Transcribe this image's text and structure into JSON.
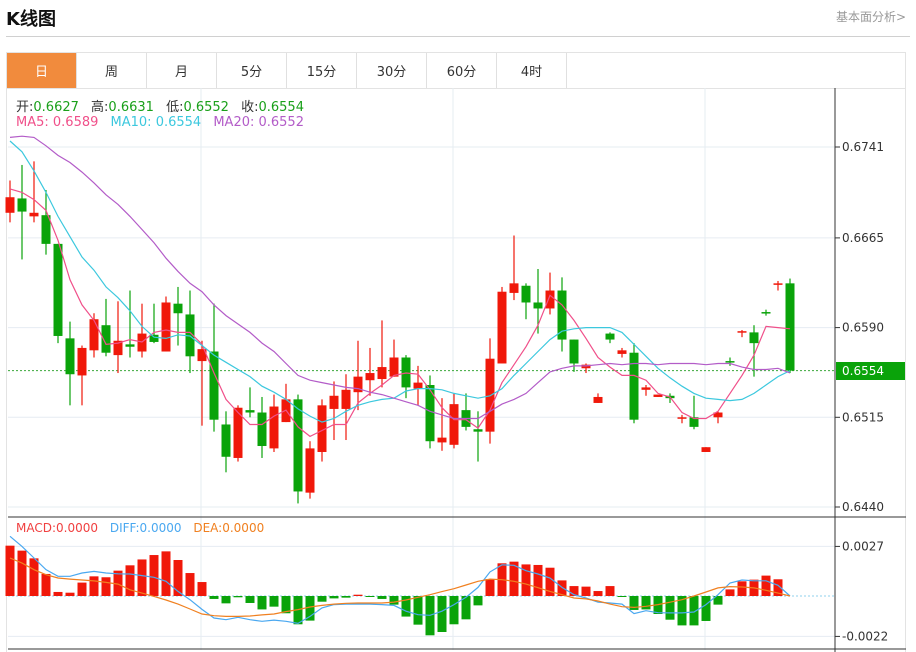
{
  "header": {
    "title": "K线图",
    "link": "基本面分析>"
  },
  "tabs": [
    {
      "label": "日",
      "active": true
    },
    {
      "label": "周"
    },
    {
      "label": "月"
    },
    {
      "label": "5分"
    },
    {
      "label": "15分"
    },
    {
      "label": "30分"
    },
    {
      "label": "60分"
    },
    {
      "label": "4时"
    }
  ],
  "ohlc": {
    "open_label": "开:",
    "open": "0.6627",
    "high_label": "高:",
    "high": "0.6631",
    "low_label": "低:",
    "low": "0.6552",
    "close_label": "收:",
    "close": "0.6554"
  },
  "ma": {
    "ma5": "MA5: 0.6589",
    "ma10": "MA10: 0.6554",
    "ma20": "MA20: 0.6552"
  },
  "macd_info": {
    "macd": "MACD:0.0000",
    "diff": "DIFF:0.0000",
    "dea": "DEA:0.0000"
  },
  "current_price": "0.6554",
  "colors": {
    "up": "#f0180a",
    "down": "#0aa30a",
    "ma5": "#f0508a",
    "ma10": "#3cc8de",
    "ma20": "#b35cc8",
    "macd": "#f04040",
    "diff": "#4aa8f0",
    "dea": "#f08020",
    "accent": "#f18b3d"
  },
  "chart_data": [
    {
      "type": "candlestick",
      "title": "K线图",
      "y_ticks": [
        "0.6741",
        "0.6665",
        "0.6590",
        "0.6515",
        "0.6440"
      ],
      "ylim": [
        0.644,
        0.6741
      ],
      "grid": true,
      "candles_ohlc": [
        [
          0.6686,
          0.6713,
          0.6678,
          0.6699
        ],
        [
          0.6698,
          0.6726,
          0.6647,
          0.6687
        ],
        [
          0.6683,
          0.6729,
          0.6678,
          0.6686
        ],
        [
          0.6684,
          0.6705,
          0.6651,
          0.666
        ],
        [
          0.666,
          0.666,
          0.6577,
          0.6583
        ],
        [
          0.6581,
          0.6595,
          0.6525,
          0.6551
        ],
        [
          0.655,
          0.6575,
          0.6525,
          0.6573
        ],
        [
          0.6571,
          0.6602,
          0.6565,
          0.6597
        ],
        [
          0.6592,
          0.6614,
          0.6566,
          0.6569
        ],
        [
          0.6567,
          0.6612,
          0.6552,
          0.6579
        ],
        [
          0.6576,
          0.6621,
          0.6565,
          0.6574
        ],
        [
          0.657,
          0.661,
          0.6565,
          0.6585
        ],
        [
          0.6584,
          0.661,
          0.6577,
          0.6578
        ],
        [
          0.657,
          0.6616,
          0.657,
          0.6611
        ],
        [
          0.661,
          0.6624,
          0.6575,
          0.6602
        ],
        [
          0.6601,
          0.6621,
          0.6552,
          0.6566
        ],
        [
          0.6562,
          0.6579,
          0.6508,
          0.6572
        ],
        [
          0.657,
          0.661,
          0.6503,
          0.6513
        ],
        [
          0.6509,
          0.652,
          0.6469,
          0.6482
        ],
        [
          0.6481,
          0.6525,
          0.6478,
          0.6523
        ],
        [
          0.6521,
          0.654,
          0.6515,
          0.6519
        ],
        [
          0.6519,
          0.6532,
          0.6481,
          0.6491
        ],
        [
          0.6489,
          0.6534,
          0.6486,
          0.6524
        ],
        [
          0.6511,
          0.6543,
          0.6511,
          0.653
        ],
        [
          0.653,
          0.6534,
          0.6443,
          0.6453
        ],
        [
          0.6452,
          0.6495,
          0.6447,
          0.6489
        ],
        [
          0.6486,
          0.653,
          0.6478,
          0.6525
        ],
        [
          0.6522,
          0.6545,
          0.6496,
          0.6533
        ],
        [
          0.6522,
          0.6551,
          0.6496,
          0.6538
        ],
        [
          0.6536,
          0.6579,
          0.6521,
          0.6549
        ],
        [
          0.6546,
          0.6573,
          0.6533,
          0.6552
        ],
        [
          0.6547,
          0.6596,
          0.654,
          0.6557
        ],
        [
          0.6549,
          0.658,
          0.6549,
          0.6565
        ],
        [
          0.6565,
          0.6567,
          0.6531,
          0.654
        ],
        [
          0.6539,
          0.6558,
          0.6525,
          0.6544
        ],
        [
          0.6542,
          0.655,
          0.6489,
          0.6495
        ],
        [
          0.6494,
          0.6531,
          0.6487,
          0.6498
        ],
        [
          0.6492,
          0.6535,
          0.6489,
          0.6526
        ],
        [
          0.6521,
          0.6535,
          0.6504,
          0.6507
        ],
        [
          0.6505,
          0.652,
          0.6478,
          0.6503
        ],
        [
          0.6503,
          0.6581,
          0.6493,
          0.6564
        ],
        [
          0.656,
          0.6624,
          0.656,
          0.662
        ],
        [
          0.6619,
          0.6667,
          0.6613,
          0.6627
        ],
        [
          0.6625,
          0.6627,
          0.6597,
          0.6611
        ],
        [
          0.6611,
          0.6639,
          0.6585,
          0.6606
        ],
        [
          0.6606,
          0.6636,
          0.6601,
          0.6621
        ],
        [
          0.6621,
          0.6632,
          0.657,
          0.658
        ],
        [
          0.658,
          0.658,
          0.6553,
          0.656
        ],
        [
          0.6556,
          0.656,
          0.6552,
          0.6559
        ],
        [
          0.6527,
          0.6535,
          0.6527,
          0.6532
        ],
        [
          0.6585,
          0.6586,
          0.6577,
          0.658
        ],
        [
          0.6568,
          0.6573,
          0.6565,
          0.6571
        ],
        [
          0.6569,
          0.6577,
          0.651,
          0.6513
        ],
        [
          0.6538,
          0.6542,
          0.6533,
          0.654
        ],
        [
          0.6532,
          0.6534,
          0.6532,
          0.6534
        ],
        [
          0.6533,
          0.6535,
          0.6527,
          0.6531
        ],
        [
          0.6514,
          0.6517,
          0.651,
          0.6515
        ],
        [
          0.6515,
          0.6533,
          0.6505,
          0.6507
        ],
        [
          0.6486,
          0.649,
          0.6486,
          0.649
        ],
        [
          0.6515,
          0.652,
          0.651,
          0.6519
        ],
        [
          0.6562,
          0.6565,
          0.6558,
          0.6561
        ],
        [
          0.6586,
          0.6588,
          0.6582,
          0.6587
        ],
        [
          0.6586,
          0.6592,
          0.6549,
          0.6577
        ],
        [
          0.6603,
          0.6605,
          0.66,
          0.6602
        ],
        [
          0.6627,
          0.6629,
          0.6621,
          0.6627
        ],
        [
          0.6627,
          0.6631,
          0.6552,
          0.6554
        ]
      ],
      "series": [
        {
          "name": "MA5",
          "values": [
            0.6706,
            0.6703,
            0.6697,
            0.6688,
            0.6663,
            0.663,
            0.6609,
            0.6596,
            0.6576,
            0.6577,
            0.658,
            0.6578,
            0.6586,
            0.6588,
            0.6586,
            0.6586,
            0.6576,
            0.6552,
            0.653,
            0.6519,
            0.6509,
            0.6509,
            0.6516,
            0.6521,
            0.6507,
            0.6499,
            0.6504,
            0.6509,
            0.6509,
            0.6527,
            0.6535,
            0.6542,
            0.655,
            0.6552,
            0.6551,
            0.6538,
            0.6523,
            0.6513,
            0.6513,
            0.6506,
            0.6521,
            0.6544,
            0.6559,
            0.6574,
            0.6592,
            0.6617,
            0.6609,
            0.6596,
            0.6581,
            0.6565,
            0.6557,
            0.655,
            0.655,
            0.6546,
            0.6535,
            0.6532,
            0.6519,
            0.6514,
            0.6514,
            0.652,
            0.6535,
            0.655,
            0.6567,
            0.6591,
            0.659,
            0.6589
          ]
        },
        {
          "name": "MA10",
          "values": [
            0.6746,
            0.6737,
            0.6721,
            0.6703,
            0.6683,
            0.6666,
            0.6649,
            0.6638,
            0.6624,
            0.6615,
            0.6604,
            0.6591,
            0.6582,
            0.6581,
            0.6584,
            0.6583,
            0.6575,
            0.6567,
            0.6561,
            0.6555,
            0.6549,
            0.6541,
            0.6536,
            0.653,
            0.6522,
            0.6516,
            0.6511,
            0.6514,
            0.652,
            0.6525,
            0.6528,
            0.653,
            0.6531,
            0.6537,
            0.6539,
            0.6539,
            0.6538,
            0.6535,
            0.6533,
            0.6531,
            0.6533,
            0.6539,
            0.655,
            0.656,
            0.657,
            0.658,
            0.6587,
            0.6589,
            0.659,
            0.659,
            0.659,
            0.6586,
            0.6576,
            0.6566,
            0.6556,
            0.6548,
            0.6541,
            0.6535,
            0.6531,
            0.653,
            0.6529,
            0.653,
            0.6535,
            0.6542,
            0.6549,
            0.6554
          ]
        },
        {
          "name": "MA20",
          "values": [
            0.6749,
            0.675,
            0.6749,
            0.6742,
            0.6734,
            0.6728,
            0.672,
            0.6711,
            0.6701,
            0.6693,
            0.6683,
            0.6672,
            0.6661,
            0.6648,
            0.6637,
            0.6627,
            0.662,
            0.6609,
            0.66,
            0.6593,
            0.6586,
            0.6577,
            0.657,
            0.656,
            0.655,
            0.6546,
            0.6544,
            0.6542,
            0.654,
            0.6539,
            0.6536,
            0.6534,
            0.6531,
            0.6528,
            0.6525,
            0.652,
            0.6517,
            0.6514,
            0.6514,
            0.6514,
            0.652,
            0.6526,
            0.653,
            0.6535,
            0.6544,
            0.6553,
            0.6556,
            0.6558,
            0.6558,
            0.6559,
            0.656,
            0.6559,
            0.656,
            0.656,
            0.6559,
            0.656,
            0.656,
            0.656,
            0.6559,
            0.656,
            0.656,
            0.6557,
            0.6555,
            0.6555,
            0.6556,
            0.6552
          ]
        }
      ]
    },
    {
      "type": "bar",
      "title": "MACD",
      "y_ticks": [
        "0.0027",
        "-0.0022"
      ],
      "ylim": [
        -0.0022,
        0.0027
      ],
      "macd": [
        0.00274,
        0.00247,
        0.00205,
        0.0012,
        0.00022,
        0.00018,
        0.00073,
        0.00107,
        0.00102,
        0.00138,
        0.00167,
        0.00199,
        0.00223,
        0.00243,
        0.00196,
        0.00125,
        0.00076,
        -0.00016,
        -0.0004,
        -7e-05,
        -0.00038,
        -0.00073,
        -0.00058,
        -0.00094,
        -0.00154,
        -0.00134,
        -0.00031,
        -0.00013,
        -9e-05,
        7e-05,
        -2e-05,
        -0.00016,
        -0.00047,
        -0.00112,
        -0.00156,
        -0.00214,
        -0.00196,
        -0.00154,
        -0.00127,
        -0.00051,
        0.00092,
        0.00178,
        0.00187,
        0.00172,
        0.00169,
        0.00154,
        0.00085,
        0.00054,
        0.00051,
        0.00027,
        0.00054,
        -4e-05,
        -0.00076,
        -0.00073,
        -0.00098,
        -0.00129,
        -0.0016,
        -0.0016,
        -0.00136,
        -0.00047,
        0.00036,
        0.0008,
        0.00089,
        0.00111,
        0.00091,
        0
      ],
      "series": [
        {
          "name": "DIFF",
          "values": [
            0.00325,
            0.0027,
            0.00207,
            0.00143,
            0.00107,
            0.00107,
            0.00125,
            0.00134,
            0.00125,
            0.00121,
            0.0012,
            0.00111,
            0.00102,
            0.0008,
            0.00025,
            -0.0002,
            -0.00073,
            -0.0012,
            -0.00129,
            -0.00116,
            -0.00129,
            -0.00138,
            -0.00131,
            -0.00138,
            -0.00149,
            -0.00111,
            -0.00065,
            -0.00047,
            -0.00044,
            -0.00044,
            -0.00044,
            -0.00047,
            -0.00051,
            -0.00083,
            -0.00102,
            -0.00105,
            -0.00083,
            -0.00047,
            -7e-05,
            0.00047,
            0.00131,
            0.0017,
            0.00167,
            0.00138,
            0.0012,
            0.00098,
            0.00047,
            7e-05,
            -0.00011,
            -0.00033,
            -0.00038,
            -0.00044,
            -0.00096,
            -0.0008,
            -0.00091,
            -0.00092,
            -0.00092,
            -0.00087,
            -0.00047,
            7e-05,
            0.00071,
            0.00087,
            0.00083,
            0.00083,
            0.00058,
            0
          ]
        },
        {
          "name": "DEA",
          "values": [
            0.00207,
            0.00179,
            0.00143,
            0.00116,
            0.00098,
            0.00092,
            0.00087,
            0.00082,
            0.00074,
            0.00065,
            0.00034,
            0.00016,
            -2e-05,
            -0.00022,
            -0.00044,
            -0.00071,
            -0.00098,
            -0.00107,
            -0.00111,
            -0.00111,
            -0.00109,
            -0.00103,
            -0.00098,
            -0.00085,
            -0.00074,
            -0.0006,
            -0.00051,
            -0.00044,
            -0.0004,
            -0.00038,
            -0.00038,
            -0.00038,
            -0.00033,
            -0.00022,
            -7e-05,
            7e-05,
            0.00024,
            0.0004,
            0.0006,
            0.0008,
            0.00092,
            0.00089,
            0.0008,
            0.00065,
            0.00045,
            0.00025,
            7e-05,
            -0.00011,
            -0.00016,
            -0.00027,
            -0.00044,
            -0.00058,
            -0.00062,
            -0.00056,
            -0.00047,
            -0.00034,
            -0.0002,
            0,
            0.00022,
            0.00044,
            0.00051,
            0.00049,
            0.00044,
            0.00031,
            0.00016,
            0
          ]
        }
      ]
    }
  ]
}
